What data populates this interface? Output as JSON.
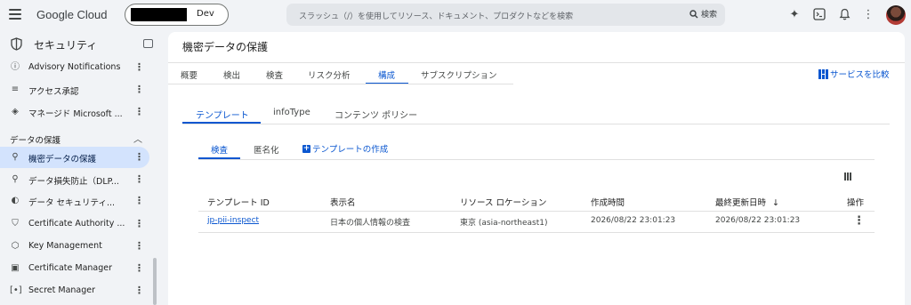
{
  "topbar": {
    "app_name": "Google Cloud",
    "project_env": "Dev",
    "search_placeholder": "スラッシュ（/）を使用してリソース、ドキュメント、プロダクトなどを検索",
    "search_button": "検索"
  },
  "sidebar": {
    "title": "セキュリティ",
    "section_label": "データの保護",
    "items": [
      {
        "label": "Advisory Notifications",
        "icon": "shield-alert-icon"
      },
      {
        "label": "アクセス承認",
        "icon": "access-approval-icon"
      },
      {
        "label": "マネージド Microsoft ...",
        "icon": "microsoft-ad-icon"
      },
      {
        "label": "機密データの保護",
        "icon": "sensitive-data-icon"
      },
      {
        "label": "データ損失防止（DLP...",
        "icon": "dlp-icon"
      },
      {
        "label": "データ セキュリティ...",
        "icon": "data-security-icon"
      },
      {
        "label": "Certificate Authority ...",
        "icon": "certificate-authority-icon"
      },
      {
        "label": "Key Management",
        "icon": "key-icon"
      },
      {
        "label": "Certificate Manager",
        "icon": "certificate-icon"
      },
      {
        "label": "Secret Manager",
        "icon": "secret-icon"
      }
    ]
  },
  "main": {
    "page_title": "機密データの保護",
    "tabs": [
      "概要",
      "検出",
      "検査",
      "リスク分析",
      "構成",
      "サブスクリプション"
    ],
    "active_tab": "構成",
    "compare_label": "サービスを比較",
    "subtabs": [
      "テンプレート",
      "infoType",
      "コンテンツ ポリシー"
    ],
    "active_subtab": "テンプレート",
    "subsubtabs": [
      "検査",
      "匿名化"
    ],
    "active_subsubtab": "検査",
    "create_label": "テンプレートの作成",
    "table": {
      "columns": [
        "テンプレート ID",
        "表示名",
        "リソース ロケーション",
        "作成時間",
        "最終更新日時",
        "操作"
      ],
      "sort_indicator": "↓",
      "rows": [
        {
          "id": "jp-pii-inspect",
          "display_name": "日本の個人情報の検査",
          "location": "東京 (asia-northeast1)",
          "created": "2026/08/22 23:01:23",
          "updated": "2026/08/22 23:01:23"
        }
      ]
    }
  },
  "colors": {
    "accent": "#0b57d0",
    "active_bg": "#d3e3fd",
    "surface": "#f1f3f6"
  }
}
